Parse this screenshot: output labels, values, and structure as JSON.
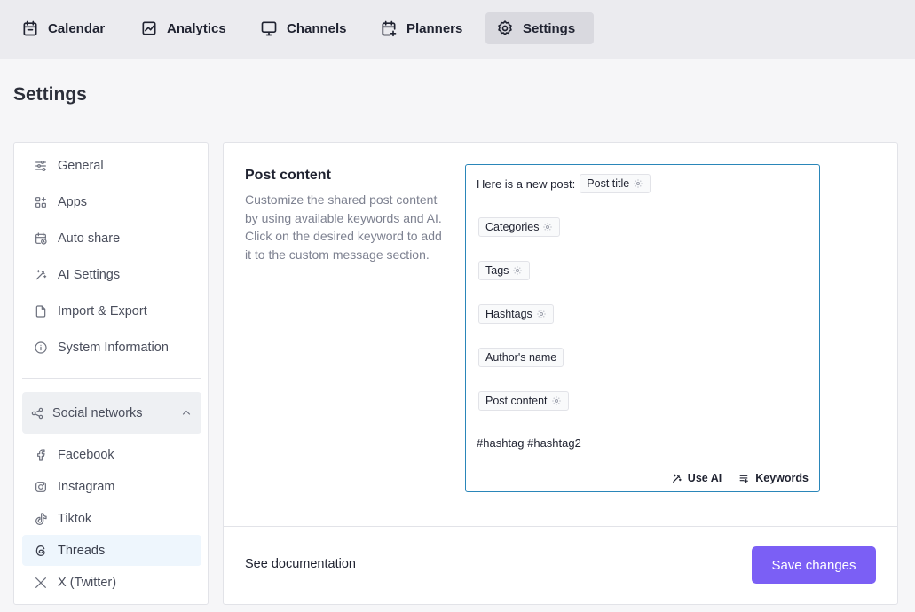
{
  "nav": {
    "tabs": [
      {
        "label": "Calendar",
        "icon": "calendar-icon"
      },
      {
        "label": "Analytics",
        "icon": "analytics-icon"
      },
      {
        "label": "Channels",
        "icon": "monitor-icon"
      },
      {
        "label": "Planners",
        "icon": "calendar-plus-icon"
      },
      {
        "label": "Settings",
        "icon": "gear-icon",
        "active": true
      }
    ]
  },
  "page": {
    "title": "Settings"
  },
  "sidebar": {
    "items": [
      {
        "label": "General",
        "icon": "sliders-icon"
      },
      {
        "label": "Apps",
        "icon": "apps-grid-icon"
      },
      {
        "label": "Auto share",
        "icon": "calendar-clock-icon"
      },
      {
        "label": "AI Settings",
        "icon": "magic-wand-icon"
      },
      {
        "label": "Import & Export",
        "icon": "file-icon"
      },
      {
        "label": "System Information",
        "icon": "info-icon"
      }
    ],
    "group": {
      "label": "Social networks",
      "icon": "share-icon",
      "expanded": true
    },
    "networks": [
      {
        "label": "Facebook",
        "icon": "facebook-icon"
      },
      {
        "label": "Instagram",
        "icon": "instagram-icon"
      },
      {
        "label": "Tiktok",
        "icon": "tiktok-icon"
      },
      {
        "label": "Threads",
        "icon": "threads-icon",
        "active": true
      },
      {
        "label": "X (Twitter)",
        "icon": "x-twitter-icon"
      }
    ]
  },
  "post_content": {
    "title": "Post content",
    "description": "Customize the shared post content by using available keywords and AI. Click on the desired keyword to add it to the custom message section.",
    "editor": {
      "intro_text": "Here is a new post:",
      "chips": {
        "post_title": "Post title",
        "categories": "Categories",
        "tags": "Tags",
        "hashtags": "Hashtags",
        "author": "Author's name",
        "post_content": "Post content"
      },
      "hashtag_line": "#hashtag #hashtag2",
      "use_ai_label": "Use AI",
      "keywords_label": "Keywords"
    }
  },
  "footer": {
    "doc_link": "See documentation",
    "save_label": "Save changes"
  },
  "colors": {
    "accent": "#7b5ff5",
    "editor_border": "#2a86b9",
    "active_nav_bg": "#d9d9df",
    "active_side_bg": "#eef6fd"
  }
}
